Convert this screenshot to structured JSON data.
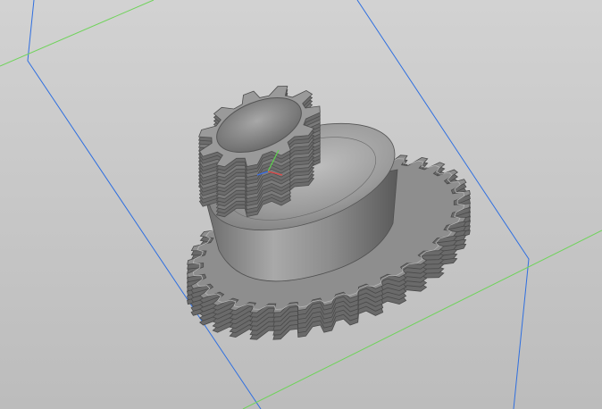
{
  "viewport": {
    "model": "gear-assembly",
    "background_top": "#d2d2d2",
    "background_bottom": "#bdbdbd",
    "plane_edge_color": "#2f6fe0",
    "axis_x_color": "#e04848",
    "axis_y_color": "#5fd34f",
    "axis_z_color": "#3a6fe8",
    "gear_base_color": "#8a8a8a",
    "gear_highlight_color": "#b9b9b9",
    "gear_shadow_color": "#5e5e5e"
  }
}
